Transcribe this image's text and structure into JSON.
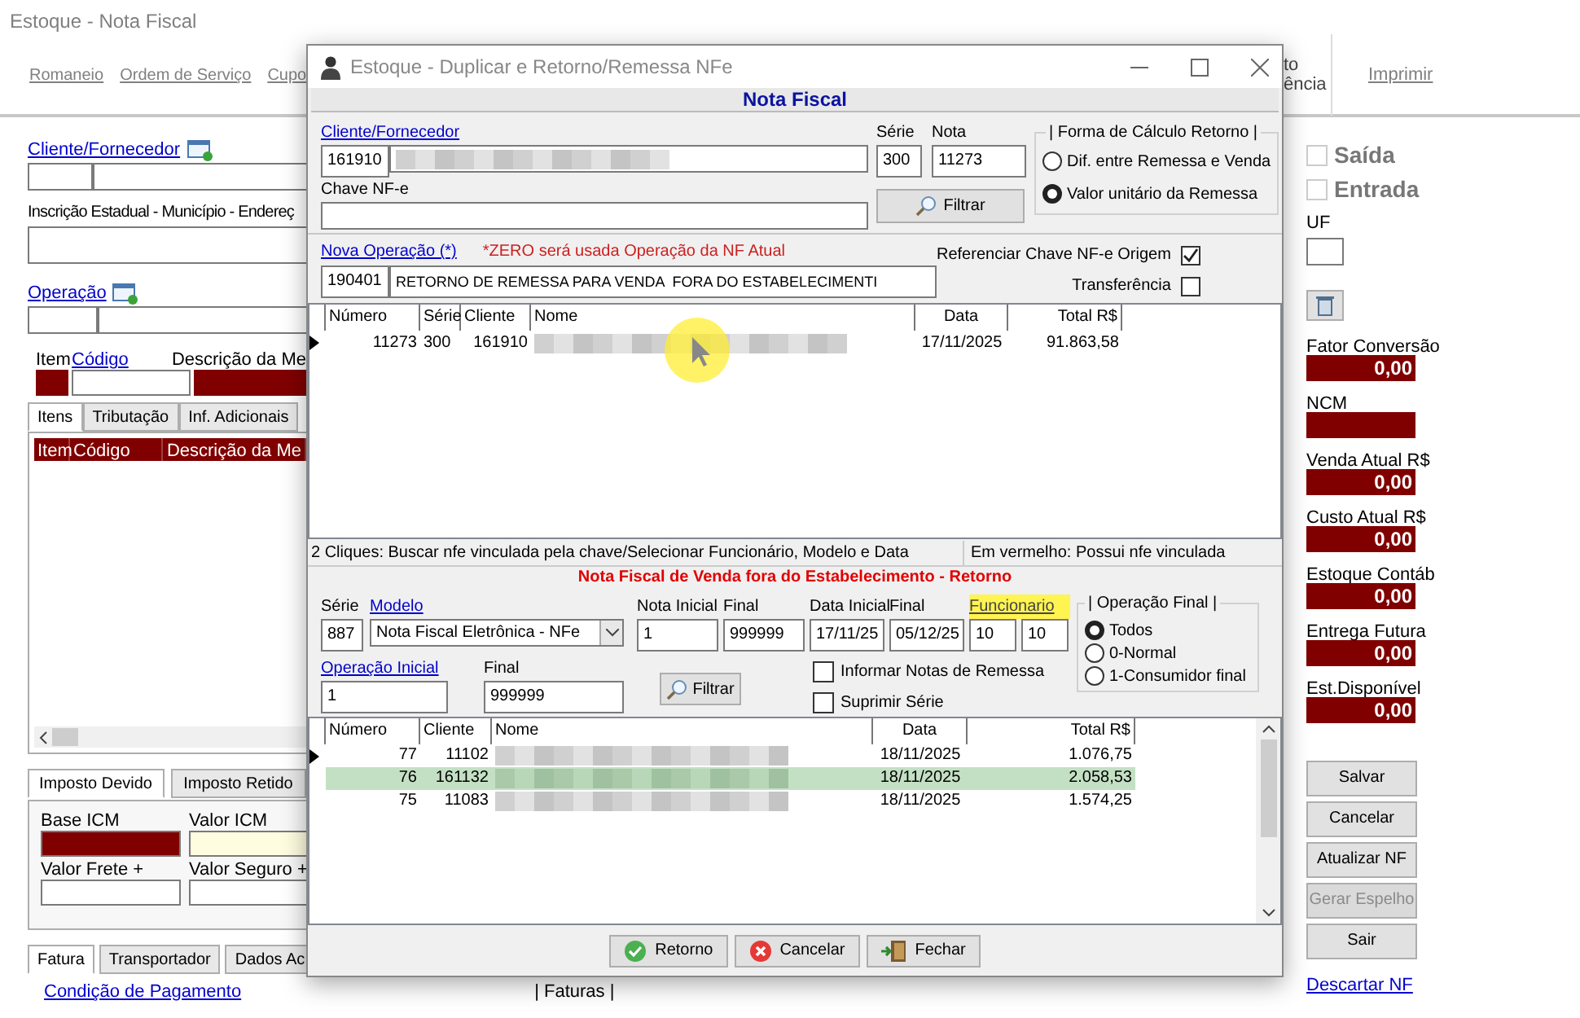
{
  "window": {
    "title": "Estoque - Nota Fiscal"
  },
  "toolbar": [
    {
      "label": "Romaneio"
    },
    {
      "label": "Ordem de Serviço"
    },
    {
      "label": "Cupo"
    }
  ],
  "toolbar_fragments": [
    "to",
    "ência"
  ],
  "toolbar_print": "Imprimir",
  "form": {
    "cliente_label": "Cliente/Fornecedor",
    "inscricao_label": "Inscrição Estadual - Município - Endereç",
    "operacao_label": "Operação",
    "item_labels": [
      "Item",
      "Código",
      "Descrição da Me"
    ]
  },
  "item_tabs": [
    {
      "label": "Itens",
      "selected": true
    },
    {
      "label": "Tributação",
      "selected": false
    },
    {
      "label": "Inf. Adicionais",
      "selected": false
    }
  ],
  "items_table": {
    "columns": [
      "Item",
      "Código",
      "Descrição da Me"
    ]
  },
  "tax_tabs": [
    {
      "label": "Imposto Devido",
      "selected": true
    },
    {
      "label": "Imposto Retido",
      "selected": false
    }
  ],
  "tax_fields": [
    {
      "label": "Base ICM",
      "kind": "dark"
    },
    {
      "label": "Valor ICM",
      "kind": "highlight"
    },
    {
      "label": "Valor Frete +",
      "kind": "plain"
    },
    {
      "label": "Valor Seguro +",
      "kind": "plain"
    }
  ],
  "bottom_tabs": [
    {
      "label": "Fatura",
      "selected": true
    },
    {
      "label": "Transportador",
      "selected": false
    },
    {
      "label": "Dados Ac",
      "selected": false
    }
  ],
  "payment_link": "Condição de Pagamento",
  "faturas_label": "| Faturas |",
  "direction": [
    {
      "label": "Saída",
      "checked": false
    },
    {
      "label": "Entrada",
      "checked": false
    }
  ],
  "uf_label": "UF",
  "indicators": [
    {
      "label": "Fator Conversão",
      "value": "0,00"
    },
    {
      "label": "NCM"
    },
    {
      "label": "Venda Atual R$",
      "value": "0,00"
    },
    {
      "label": "Custo Atual R$",
      "value": "0,00"
    },
    {
      "label": "Estoque Contáb",
      "value": "0,00"
    },
    {
      "label": "Entrega Futura",
      "value": "0,00"
    },
    {
      "label": "Est.Disponível",
      "value": "0,00"
    }
  ],
  "actions": [
    {
      "label": "Salvar",
      "disabled": false
    },
    {
      "label": "Cancelar",
      "disabled": false
    },
    {
      "label": "Atualizar NF",
      "disabled": false
    },
    {
      "label": "Gerar Espelho",
      "disabled": true
    },
    {
      "label": "Sair",
      "disabled": false
    }
  ],
  "discard_link": "Descartar NF",
  "dialog": {
    "title": "Estoque - Duplicar e Retorno/Remessa NFe",
    "section_1": "Nota Fiscal",
    "cliente": {
      "label": "Cliente/Fornecedor",
      "code": "161910"
    },
    "serie": {
      "label": "Série",
      "value": "300"
    },
    "nota": {
      "label": "Nota",
      "value": "11273"
    },
    "chave": {
      "label": "Chave NF-e"
    },
    "filter_button": "Filtrar",
    "calc_group": {
      "title": "| Forma de Cálculo Retorno |",
      "options": [
        {
          "label": "Dif. entre Remessa e Venda",
          "selected": false
        },
        {
          "label": "Valor unitário da Remessa",
          "selected": true
        }
      ]
    },
    "operacao": {
      "label": "Nova Operação (*)",
      "note": "*ZERO será usada Operação da NF Atual",
      "code": "190401",
      "description": "RETORNO DE REMESSA PARA VENDA  FORA DO ESTABELECIMENTI"
    },
    "options": [
      {
        "label": "Referenciar Chave NF-e Origem",
        "checked": true
      },
      {
        "label": "Transferência",
        "checked": false
      }
    ],
    "notes_table": {
      "columns": [
        "Número",
        "Série",
        "Cliente",
        "Nome",
        "Data",
        "Total R$"
      ],
      "rows": [
        {
          "numero": "11273",
          "serie": "300",
          "cliente": "161910",
          "data": "17/11/2025",
          "total": "91.863,58",
          "current": true
        }
      ]
    },
    "hint": "2 Cliques: Buscar nfe vinculada pela chave/Selecionar Funcionário, Modelo e Data",
    "legend": "Em vermelho: Possui nfe vinculada",
    "section_2": "Nota Fiscal de Venda fora do Estabelecimento - Retorno",
    "filters": {
      "serie": {
        "label": "Série",
        "value": "887"
      },
      "modelo": {
        "label": "Modelo",
        "value": "Nota Fiscal Eletrônica - NFe"
      },
      "nota_inicial": {
        "label": "Nota Inicial",
        "value": "1"
      },
      "nota_final": {
        "label": "Final",
        "value": "999999"
      },
      "data_inicial": {
        "label": "Data Inicial",
        "value": "17/11/25"
      },
      "data_final": {
        "label": "Final",
        "value": "05/12/25"
      },
      "funcionario": {
        "label": "Funcionario",
        "from": "10",
        "to": "10",
        "highlighted": true
      },
      "operacao_inicial": {
        "label": "Operação Inicial",
        "value": "1"
      },
      "operacao_final": {
        "label": "Final",
        "value": "999999"
      },
      "button": "Filtrar",
      "checks": [
        {
          "label": "Informar Notas de Remessa",
          "checked": false
        },
        {
          "label": "Suprimir Série",
          "checked": false
        }
      ],
      "final_group": {
        "title": "| Operação Final |",
        "options": [
          {
            "label": "Todos",
            "selected": true
          },
          {
            "label": "0-Normal",
            "selected": false
          },
          {
            "label": "1-Consumidor final",
            "selected": false
          }
        ]
      }
    },
    "sales_table": {
      "columns": [
        "Número",
        "Cliente",
        "Nome",
        "Data",
        "Total R$"
      ],
      "rows": [
        {
          "numero": "77",
          "cliente": "11102",
          "data": "18/11/2025",
          "total": "1.076,75",
          "current": true,
          "selected": false
        },
        {
          "numero": "76",
          "cliente": "161132",
          "data": "18/11/2025",
          "total": "2.058,53",
          "current": false,
          "selected": true
        },
        {
          "numero": "75",
          "cliente": "11083",
          "data": "18/11/2025",
          "total": "1.574,25",
          "current": false,
          "selected": false
        }
      ]
    },
    "buttons": [
      {
        "label": "Retorno",
        "kind": "confirm"
      },
      {
        "label": "Cancelar",
        "kind": "cancel"
      },
      {
        "label": "Fechar",
        "kind": "close"
      }
    ]
  }
}
